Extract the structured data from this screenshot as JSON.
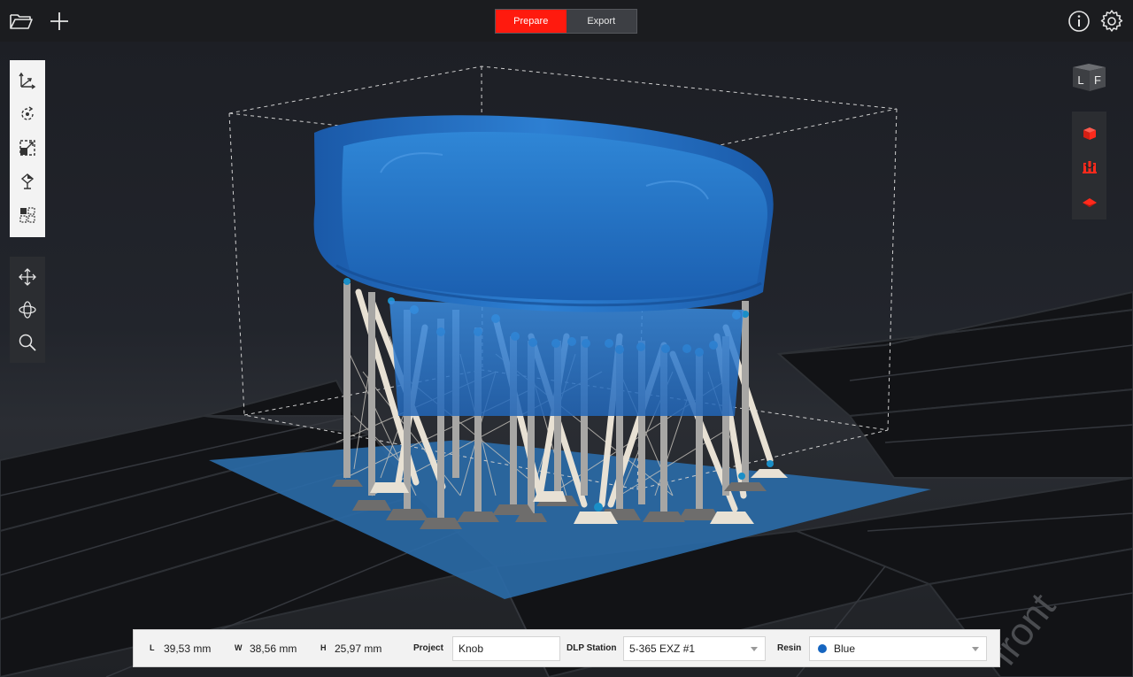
{
  "toolbar": {
    "open_icon": "folder-open-icon",
    "add_icon": "plus-icon",
    "tabs": [
      {
        "label": "Prepare",
        "active": true
      },
      {
        "label": "Export",
        "active": false
      }
    ],
    "info_icon": "info-icon",
    "settings_icon": "gear-icon",
    "accent_color": "#ff1a0e"
  },
  "left_tools": {
    "transform": [
      "move-axes-icon",
      "rotate-icon",
      "scale-icon",
      "support-icon",
      "layout-icon"
    ],
    "view": [
      "pan-icon",
      "orbit-icon",
      "zoom-icon"
    ]
  },
  "viewcube": {
    "left_face": "L",
    "front_face": "F"
  },
  "right_tools": [
    "model-view-icon",
    "supports-view-icon",
    "slice-view-icon"
  ],
  "dimensions": {
    "length_key": "L",
    "length": "39,53 mm",
    "width_key": "W",
    "width": "38,56 mm",
    "height_key": "H",
    "height": "25,97 mm"
  },
  "project": {
    "label": "Project",
    "value": "Knob"
  },
  "station": {
    "label": "DLP Station",
    "value": "5-365 EXZ #1"
  },
  "resin": {
    "label": "Resin",
    "value": "Blue",
    "color": "#1565c0"
  },
  "floor_label": "front"
}
